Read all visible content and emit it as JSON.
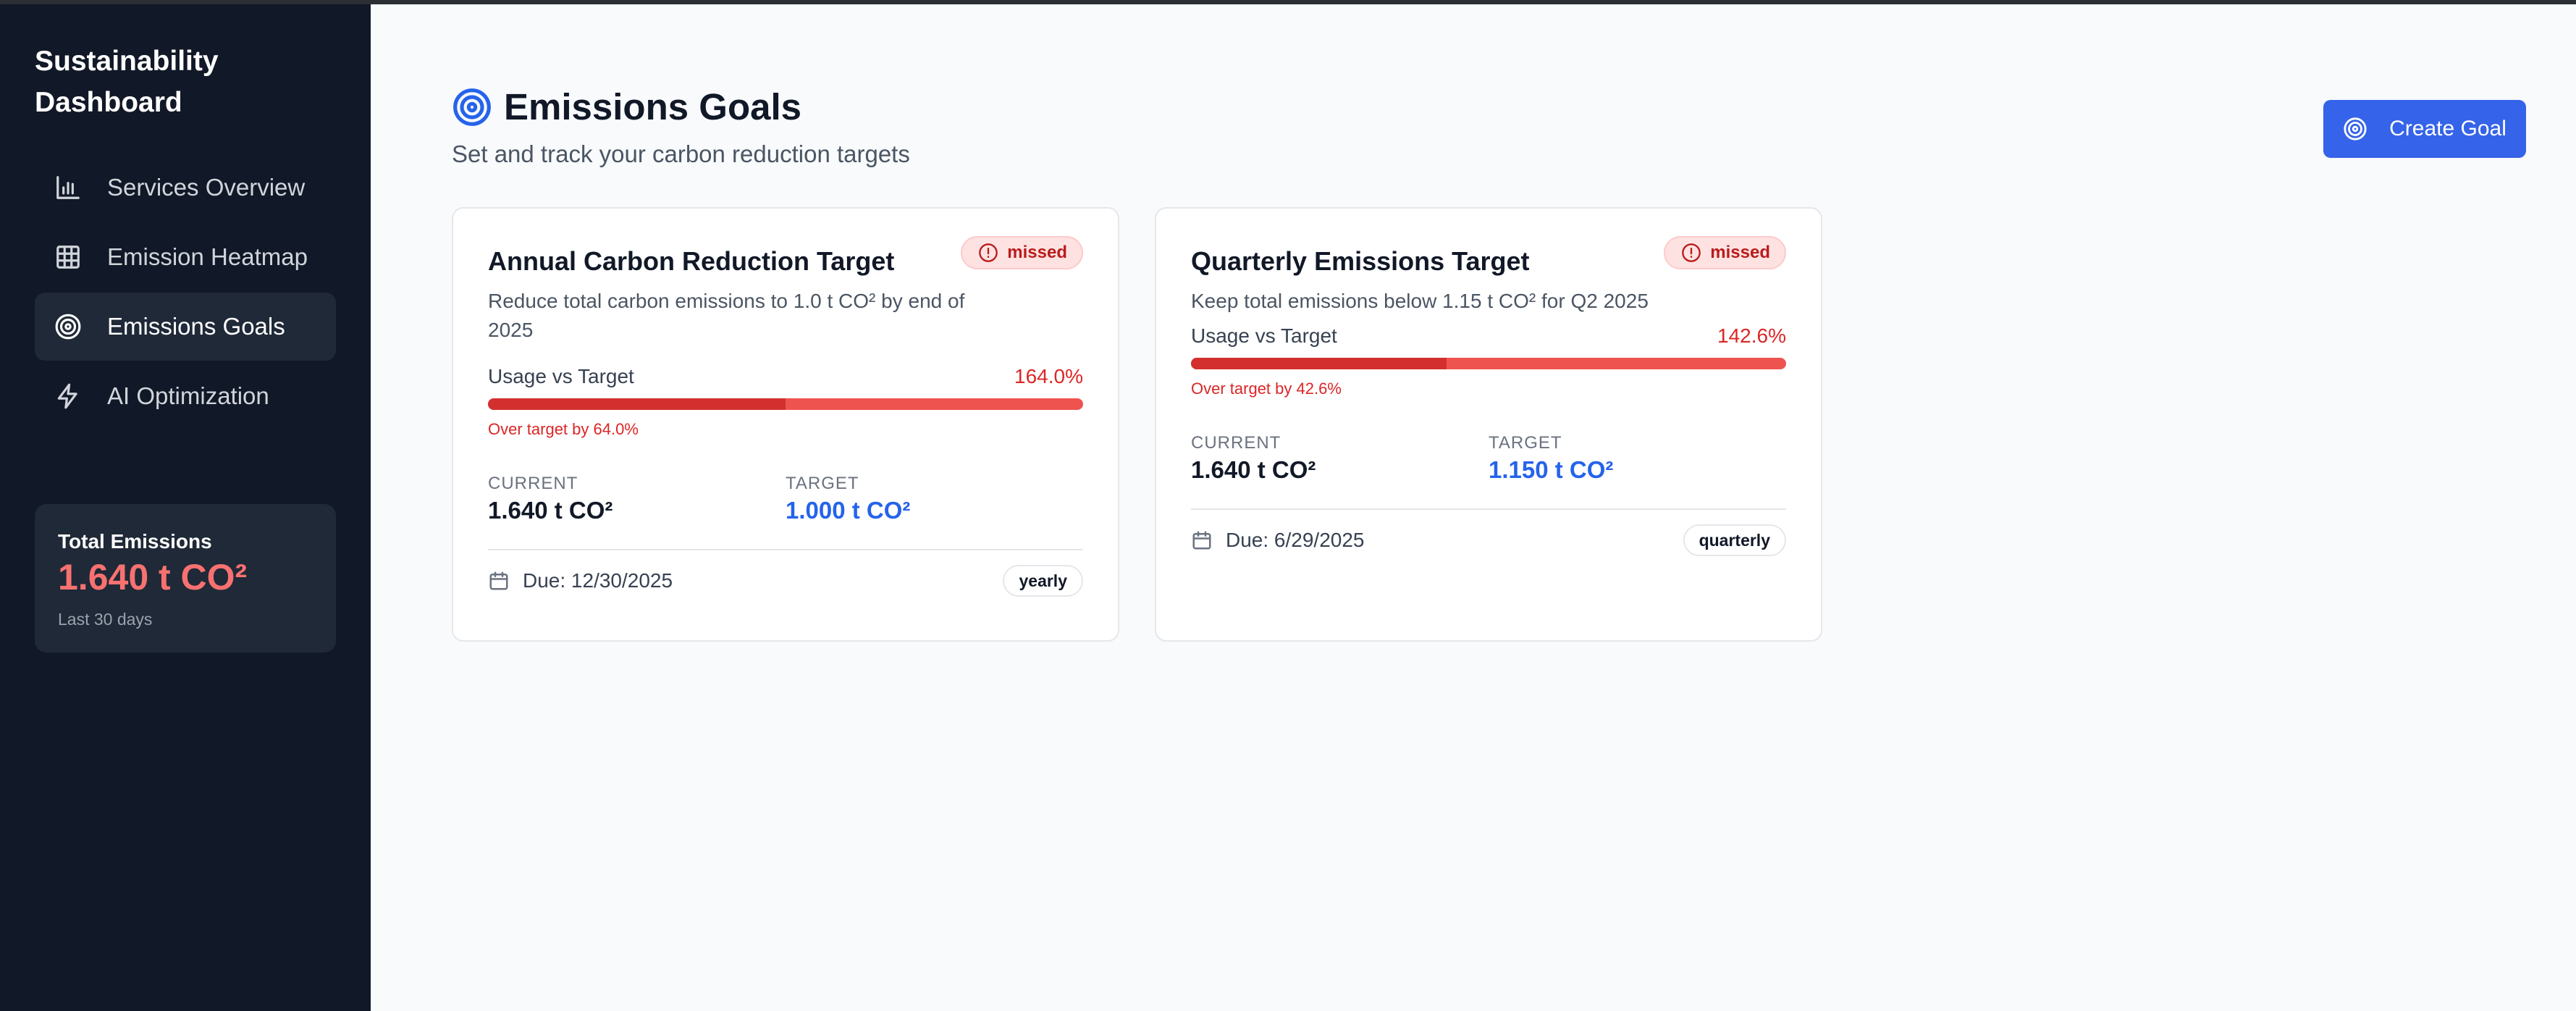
{
  "sidebar": {
    "brand": "Sustainability Dashboard",
    "items": [
      {
        "label": "Services Overview",
        "icon": "bar-chart-icon",
        "active": false
      },
      {
        "label": "Emission Heatmap",
        "icon": "grid-icon",
        "active": false
      },
      {
        "label": "Emissions Goals",
        "icon": "target-icon",
        "active": true
      },
      {
        "label": "AI Optimization",
        "icon": "lightning-icon",
        "active": false
      }
    ],
    "total": {
      "label": "Total Emissions",
      "value": "1.640 t CO²",
      "period": "Last 30 days"
    }
  },
  "header": {
    "title": "Emissions Goals",
    "subtitle": "Set and track your carbon reduction targets",
    "create_button": "Create Goal"
  },
  "goals": [
    {
      "title": "Annual Carbon Reduction Target",
      "status": "missed",
      "description": "Reduce total carbon emissions to 1.0 t CO² by end of 2025",
      "usage_label": "Usage vs Target",
      "usage_pct": "164.0%",
      "usage_fill_fraction": 0.5,
      "over_text": "Over target by 64.0%",
      "current_label": "CURRENT",
      "current_value": "1.640 t CO²",
      "target_label": "TARGET",
      "target_value": "1.000 t CO²",
      "due": "Due: 12/30/2025",
      "period": "yearly"
    },
    {
      "title": "Quarterly Emissions Target",
      "status": "missed",
      "description": "Keep total emissions below 1.15 t CO² for Q2 2025",
      "usage_label": "Usage vs Target",
      "usage_pct": "142.6%",
      "usage_fill_fraction": 0.43,
      "over_text": "Over target by 42.6%",
      "current_label": "CURRENT",
      "current_value": "1.640 t CO²",
      "target_label": "TARGET",
      "target_value": "1.150 t CO²",
      "due": "Due: 6/29/2025",
      "period": "quarterly"
    }
  ],
  "colors": {
    "sidebar_bg": "#111827",
    "accent": "#3563e9",
    "danger": "#dc2626",
    "total_value": "#f87171"
  }
}
